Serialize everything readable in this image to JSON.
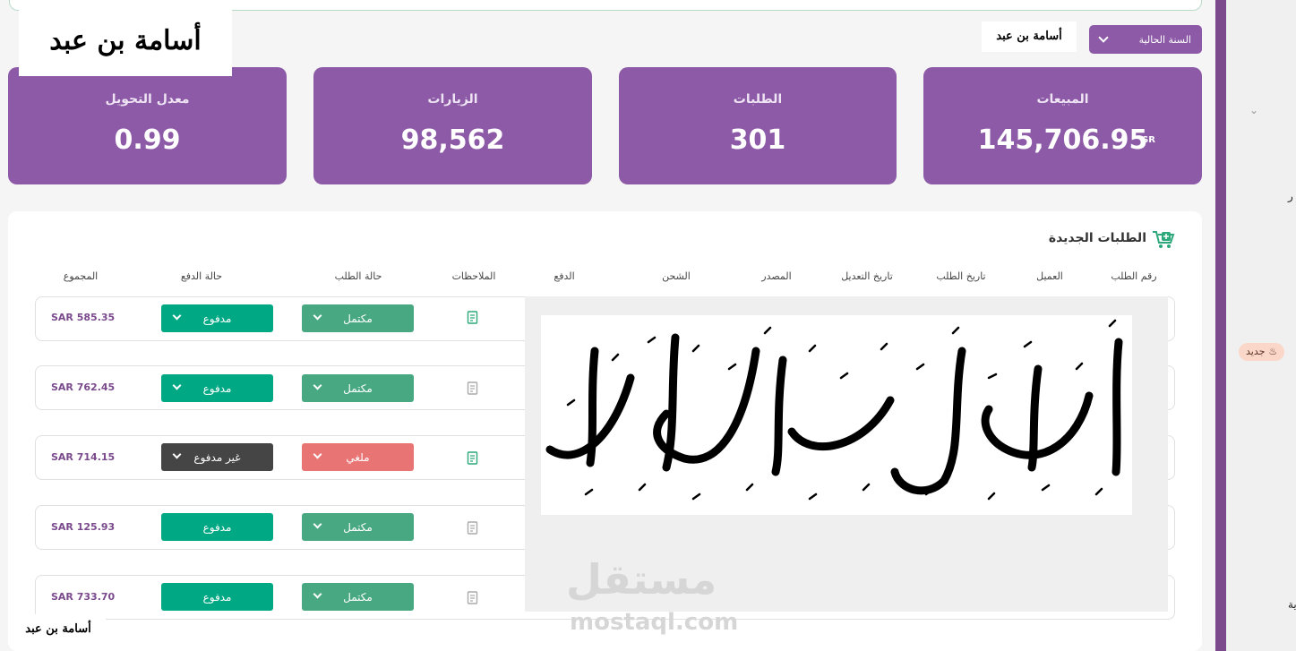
{
  "year_select": {
    "label": "السنة الحالية"
  },
  "stats": [
    {
      "label": "المبيعات",
      "value": "145,706.95",
      "currency": "SR"
    },
    {
      "label": "الطلبات",
      "value": "301"
    },
    {
      "label": "الزيارات",
      "value": "98,562"
    },
    {
      "label": "معدل التحويل",
      "value": "0.99"
    }
  ],
  "orders": {
    "title": "الطلبات الجديدة",
    "columns": [
      "رقم الطلب",
      "العميل",
      "تاريخ الطلب",
      "تاريخ التعديل",
      "المصدر",
      "الشحن",
      "الدفع",
      "الملاحظات",
      "حالة الطلب",
      "حالة الدفع",
      "المجموع"
    ],
    "rows": [
      {
        "total": "SAR 585.35",
        "status": "مكتمل",
        "payment": "مدفوع"
      },
      {
        "total": "SAR 762.45",
        "status": "مكتمل",
        "payment": "مدفوع"
      },
      {
        "total": "SAR 714.15",
        "status": "ملغي",
        "payment": "غير مدفوع"
      },
      {
        "total": "SAR 125.93",
        "status": "مكتمل",
        "payment": "مدفوع"
      },
      {
        "total": "SAR 733.70",
        "status": "مكتمل",
        "payment": "مدفوع"
      }
    ]
  },
  "sidebar": {
    "badge_new": "جديد",
    "frag_1": "ر",
    "frag_2": "ية"
  },
  "watermark": {
    "arabic": "مستقل",
    "latin": "mostaql.com"
  },
  "calligraphy": "أسامة بن عبد الجواد",
  "colors": {
    "purple": "#8c5aa6",
    "green": "#48a882",
    "teal": "#00a884",
    "red": "#e87474",
    "dark": "#454545"
  }
}
